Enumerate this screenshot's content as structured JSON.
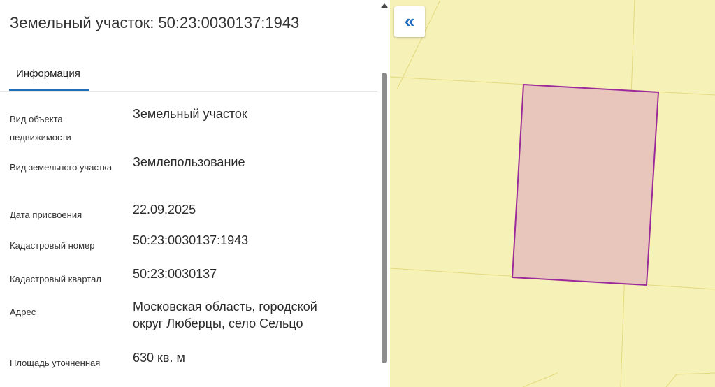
{
  "panel": {
    "title": "Земельный участок: 50:23:0030137:1943",
    "tab": "Информация",
    "fields": [
      {
        "label": "Вид объекта недвижимости",
        "value": "Земельный участок"
      },
      {
        "label": "Вид земельного участка",
        "value": "Землепользование"
      },
      {
        "label": "Дата присвоения",
        "value": "22.09.2025"
      },
      {
        "label": "Кадастровый номер",
        "value": "50:23:0030137:1943"
      },
      {
        "label": "Кадастровый квартал",
        "value": "50:23:0030137"
      },
      {
        "label": "Адрес",
        "value": "Московская область, городской округ Люберцы, село Сельцо"
      },
      {
        "label": "Площадь уточненная",
        "value": "630 кв. м"
      }
    ]
  },
  "map": {
    "collapse_icon": "double-chevron-left-icon",
    "collapse_symbol": "«",
    "background_color": "#f6f1b6",
    "parcel_fill": "#e8c6bb",
    "parcel_stroke": "#9b2a9b"
  }
}
